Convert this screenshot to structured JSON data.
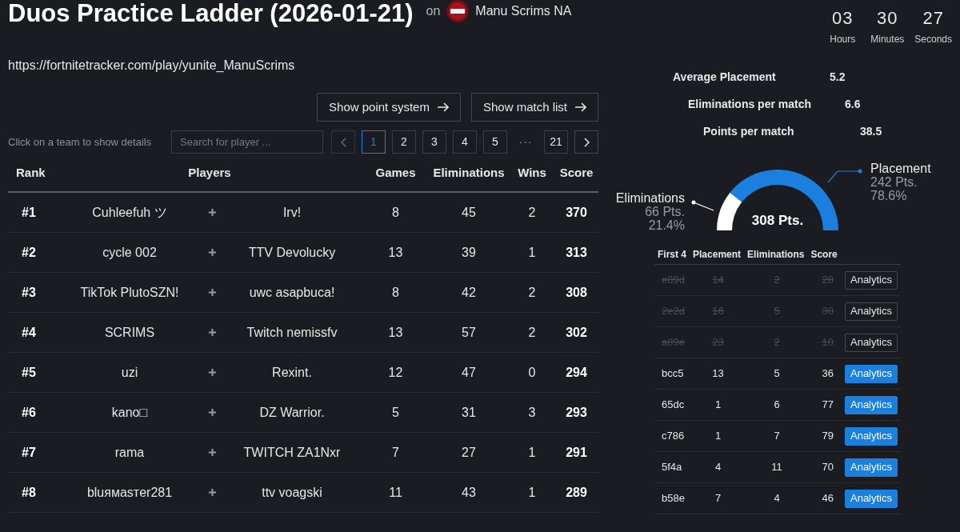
{
  "header": {
    "title": "Duos Practice Ladder (2026-01-21)",
    "host_prefix": "on",
    "host_name": "Manu Scrims NA"
  },
  "countdown": [
    {
      "value": "03",
      "unit": "Hours"
    },
    {
      "value": "30",
      "unit": "Minutes"
    },
    {
      "value": "27",
      "unit": "Seconds"
    }
  ],
  "url": "https://fortnitetracker.com/play/yunite_ManuScrims",
  "action_buttons": [
    {
      "label": "Show point system"
    },
    {
      "label": "Show match list"
    }
  ],
  "hint": "Click on a team to show details",
  "search": {
    "placeholder": "Search for player ..."
  },
  "pagination": {
    "previous": {
      "disabled": true
    },
    "pages": [
      {
        "kind": "page",
        "label": "1",
        "selected": true
      },
      {
        "kind": "page",
        "label": "2",
        "selected": false
      },
      {
        "kind": "page",
        "label": "3",
        "selected": false
      },
      {
        "kind": "page",
        "label": "4",
        "selected": false
      },
      {
        "kind": "page",
        "label": "5",
        "selected": false
      },
      {
        "kind": "ellipsis",
        "label": "···",
        "selected": false
      },
      {
        "kind": "page",
        "label": "21",
        "selected": false
      }
    ],
    "next": {
      "disabled": false
    }
  },
  "leaderboard": {
    "columns": [
      "Rank",
      "Players",
      "Games",
      "Eliminations",
      "Wins",
      "Score"
    ],
    "rows": [
      {
        "rank": "#1",
        "players": [
          "Cuhleefuh ツ",
          "Irv!"
        ],
        "games": "8",
        "eliminations": "45",
        "wins": "2",
        "score": "370"
      },
      {
        "rank": "#2",
        "players": [
          "cycle 002",
          "TTV Devolucky"
        ],
        "games": "13",
        "eliminations": "39",
        "wins": "1",
        "score": "313"
      },
      {
        "rank": "#3",
        "players": [
          "TikTok PlutoSZN!",
          "uwc asapbuca!"
        ],
        "games": "8",
        "eliminations": "42",
        "wins": "2",
        "score": "308"
      },
      {
        "rank": "#4",
        "players": [
          "SCRIMS",
          "Twitch nemissfv"
        ],
        "games": "13",
        "eliminations": "57",
        "wins": "2",
        "score": "302"
      },
      {
        "rank": "#5",
        "players": [
          "uzi",
          "Rexint."
        ],
        "games": "12",
        "eliminations": "47",
        "wins": "0",
        "score": "294"
      },
      {
        "rank": "#6",
        "players": [
          "kano□",
          "DZ Warrior."
        ],
        "games": "5",
        "eliminations": "31",
        "wins": "3",
        "score": "293"
      },
      {
        "rank": "#7",
        "players": [
          "rama",
          "TWITCH ZA1Nxr"
        ],
        "games": "7",
        "eliminations": "27",
        "wins": "1",
        "score": "291"
      },
      {
        "rank": "#8",
        "players": [
          "bluямasтer281",
          "ttv voagski"
        ],
        "games": "11",
        "eliminations": "43",
        "wins": "1",
        "score": "289"
      }
    ]
  },
  "summary": {
    "stats": [
      {
        "label": "Average Placement",
        "value": "5.2"
      },
      {
        "label": "Eliminations per match",
        "value": "6.6"
      },
      {
        "label": "Points per match",
        "value": "38.5"
      }
    ],
    "gauge": {
      "total": "308 Pts.",
      "slices": [
        {
          "points": "66 Pts.",
          "share": "21.4%",
          "color": "#ffffff"
        },
        {
          "points": "242 Pts.",
          "share": "78.6%",
          "color": "#1a7fdd"
        }
      ],
      "chart_data": {
        "type": "donut",
        "categories": [
          "Eliminations",
          "Placement"
        ],
        "values": [
          21.4,
          78.6
        ]
      }
    },
    "matches": {
      "columns": [
        "First 4",
        "Placement",
        "Eliminations",
        "Score"
      ],
      "rows": [
        {
          "id": "e89d",
          "placement": "14",
          "eliminations": "2",
          "score": "28",
          "counted": false,
          "button": "Analytics"
        },
        {
          "id": "2e2d",
          "placement": "16",
          "eliminations": "5",
          "score": "30",
          "counted": false,
          "button": "Analytics"
        },
        {
          "id": "a89e",
          "placement": "23",
          "eliminations": "2",
          "score": "10",
          "counted": false,
          "button": "Analytics"
        },
        {
          "id": "bcc5",
          "placement": "13",
          "eliminations": "5",
          "score": "36",
          "counted": true,
          "button": "Analytics"
        },
        {
          "id": "65dc",
          "placement": "1",
          "eliminations": "6",
          "score": "77",
          "counted": true,
          "button": "Analytics"
        },
        {
          "id": "c786",
          "placement": "1",
          "eliminations": "7",
          "score": "79",
          "counted": true,
          "button": "Analytics"
        },
        {
          "id": "5f4a",
          "placement": "4",
          "eliminations": "11",
          "score": "70",
          "counted": true,
          "button": "Analytics"
        },
        {
          "id": "b58e",
          "placement": "7",
          "eliminations": "4",
          "score": "46",
          "counted": true,
          "button": "Analytics"
        }
      ]
    }
  }
}
